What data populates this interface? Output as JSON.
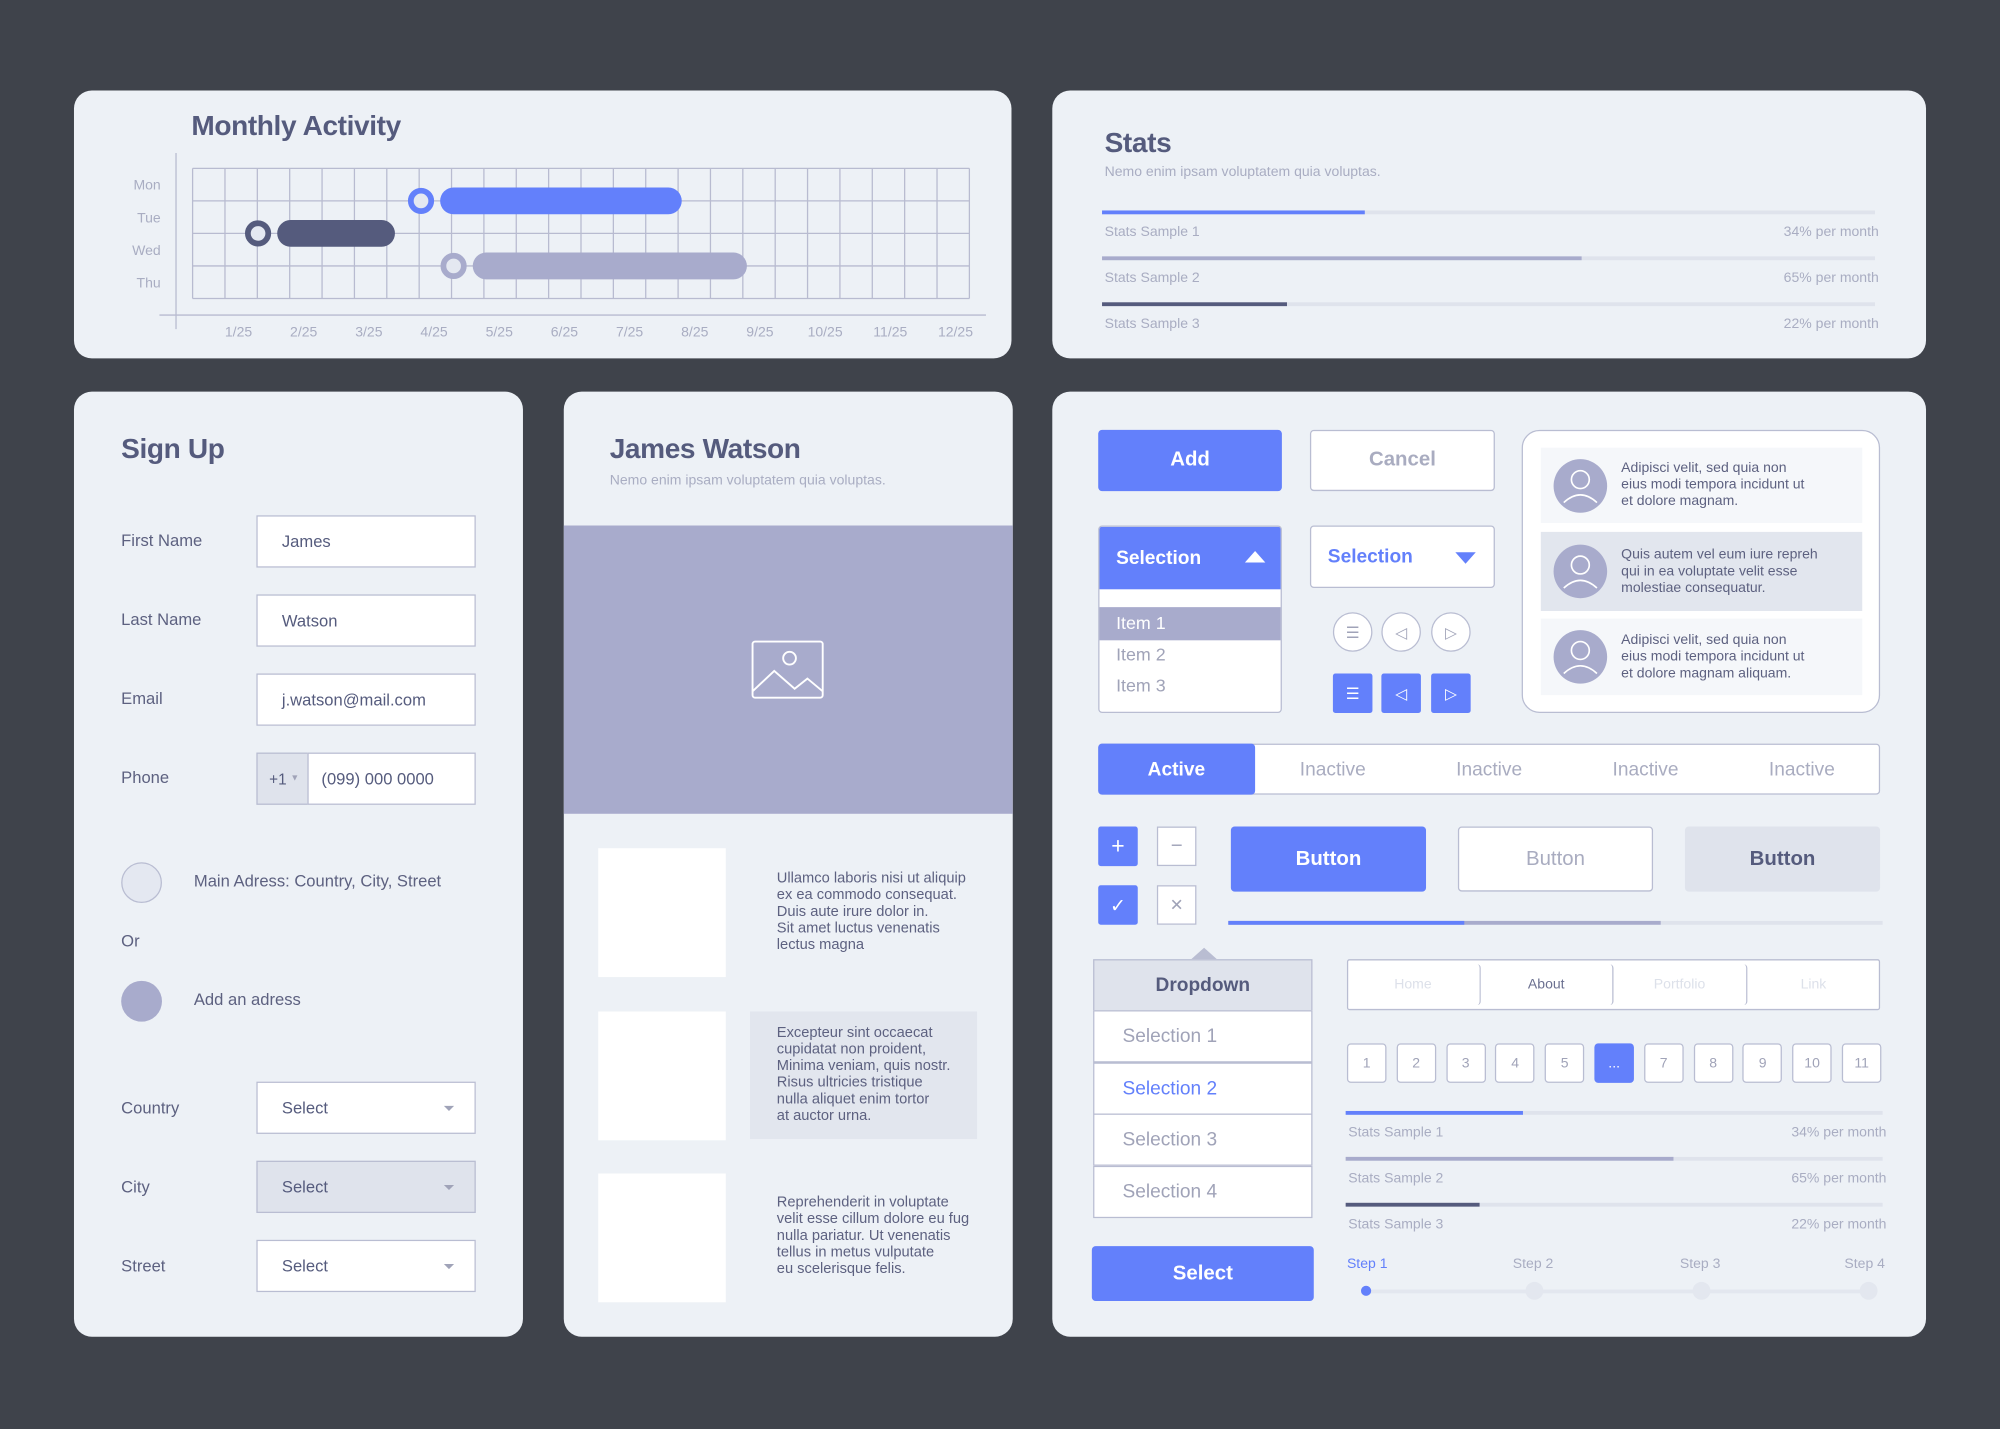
{
  "colors": {
    "accent": "#6380fb",
    "dark": "#555b7d",
    "lavender": "#a8abcc",
    "background": "#3f434b",
    "card": "#edf1f6"
  },
  "monthly": {
    "title": "Monthly Activity",
    "chart_data": {
      "type": "gantt",
      "rows": [
        "Mon",
        "Tue",
        "Wed",
        "Thu"
      ],
      "x_ticks": [
        "1/25",
        "2/25",
        "3/25",
        "4/25",
        "5/25",
        "6/25",
        "7/25",
        "8/25",
        "9/25",
        "10/25",
        "11/25",
        "12/25"
      ],
      "bars": [
        {
          "row": "Tue",
          "start_month": 3.8,
          "end_month": 7.8,
          "color": "#6380fb"
        },
        {
          "row": "Wed",
          "start_month": 1.3,
          "end_month": 3.4,
          "color": "#555b7d"
        },
        {
          "row": "Thu",
          "start_month": 4.3,
          "end_month": 8.8,
          "color": "#a8abcc"
        }
      ]
    }
  },
  "stats": {
    "title": "Stats",
    "subtitle": "Nemo enim ipsam voluptatem quia voluptas.",
    "items": [
      {
        "label": "Stats Sample 1",
        "value": "34% per month",
        "percent": 34,
        "color": "#6380fb"
      },
      {
        "label": "Stats Sample 2",
        "value": "65% per month",
        "percent": 62,
        "color": "#a8abcc"
      },
      {
        "label": "Stats Sample 3",
        "value": "22% per month",
        "percent": 24,
        "color": "#555b7d"
      }
    ]
  },
  "signup": {
    "title": "Sign Up",
    "first_name": {
      "label": "First Name",
      "value": "James"
    },
    "last_name": {
      "label": "Last Name",
      "value": "Watson"
    },
    "email": {
      "label": "Email",
      "value": "j.watson@mail.com"
    },
    "phone": {
      "label": "Phone",
      "prefix": "+1",
      "value": "(099) 000 0000"
    },
    "address_main": "Main Adress: Country, City, Street",
    "or": "Or",
    "address_add": "Add an adress",
    "country": {
      "label": "Country",
      "value": "Select"
    },
    "city": {
      "label": "City",
      "value": "Select"
    },
    "street": {
      "label": "Street",
      "value": "Select"
    }
  },
  "profile": {
    "title": "James Watson",
    "subtitle": "Nemo enim ipsam voluptatem quia voluptas.",
    "items": [
      "Ullamco laboris nisi ut aliquip\nex ea commodo consequat.\nDuis aute irure dolor in.\nSit amet luctus venenatis\nlectus magna",
      "Excepteur sint occaecat\ncupidatat non proident,\nMinima veniam, quis nostr.\nRisus ultricies tristique\nnulla aliquet enim tortor\nat auctor urna.",
      "Reprehenderit in voluptate\nvelit esse cillum dolore eu fug\nnulla pariatur. Ut venenatis\ntellus in metus vulputate\neu scelerisque felis."
    ]
  },
  "kit": {
    "add": "Add",
    "cancel": "Cancel",
    "selection_open": {
      "label": "Selection",
      "items": [
        "Item 1",
        "Item 2",
        "Item 3"
      ]
    },
    "selection_closed": "Selection",
    "messages": [
      "Adipisci velit, sed quia non\neius modi tempora incidunt ut\net dolore magnam.",
      "Quis autem vel eum iure repreh\nqui in ea voluptate velit esse\nmolestiae consequatur.",
      "Adipisci velit, sed quia non\neius modi tempora incidunt ut\net dolore magnam aliquam."
    ],
    "tabs": [
      "Active",
      "Inactive",
      "Inactive",
      "Inactive",
      "Inactive"
    ],
    "buttons": [
      "Button",
      "Button",
      "Button"
    ],
    "slider": {
      "value_percent": 36,
      "secondary_percent": 66
    },
    "dropdown": {
      "header": "Dropdown",
      "items": [
        "Selection 1",
        "Selection 2",
        "Selection 3",
        "Selection 4"
      ],
      "selected": "Selection 2"
    },
    "select_button": "Select",
    "nav": [
      "Home",
      "About",
      "Portfolio",
      "Link"
    ],
    "pagination": [
      "1",
      "2",
      "3",
      "4",
      "5",
      "...",
      "7",
      "8",
      "9",
      "10",
      "11"
    ],
    "pagination_active": "...",
    "stats": [
      {
        "label": "Stats Sample 1",
        "value": "34% per month",
        "percent": 33,
        "color": "#6380fb"
      },
      {
        "label": "Stats Sample 2",
        "value": "65% per month",
        "percent": 61,
        "color": "#a8abcc"
      },
      {
        "label": "Stats Sample 3",
        "value": "22% per month",
        "percent": 25,
        "color": "#555b7d"
      }
    ],
    "steps": [
      "Step 1",
      "Step 2",
      "Step 3",
      "Step 4"
    ],
    "current_step": 1
  }
}
